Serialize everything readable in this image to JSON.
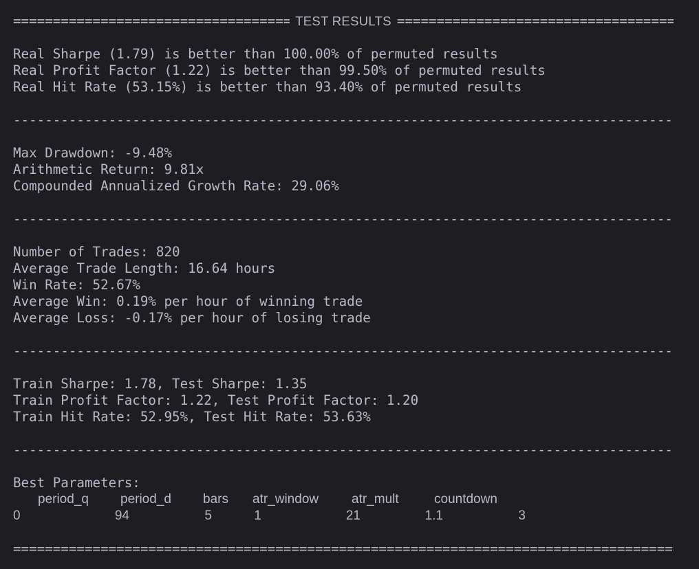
{
  "header": {
    "title": "TEST RESULTS",
    "fill": "================================================================"
  },
  "rules": {
    "equals": "=============================================================================================",
    "dashes": "---------------------------------------------------------------------------------------------"
  },
  "permutation": {
    "line1": "Real Sharpe (1.79) is better than 100.00% of permuted results",
    "line2": "Real Profit Factor (1.22) is better than 99.50% of permuted results",
    "line3": "Real Hit Rate (53.15%) is better than 93.40% of permuted results"
  },
  "returns": {
    "drawdown": "Max Drawdown: -9.48%",
    "arith": "Arithmetic Return: 9.81x",
    "cagr": "Compounded Annualized Growth Rate: 29.06%"
  },
  "trades": {
    "count": "Number of Trades: 820",
    "length": "Average Trade Length: 16.64 hours",
    "winrate": "Win Rate: 52.67%",
    "avgwin": "Average Win: 0.19% per hour of winning trade",
    "avgloss": "Average Loss: -0.17% per hour of losing trade"
  },
  "split": {
    "sharpe": "Train Sharpe: 1.78, Test Sharpe: 1.35",
    "pf": "Train Profit Factor: 1.22, Test Profit Factor: 1.20",
    "hit": "Train Hit Rate: 52.95%, Test Hit Rate: 53.63%"
  },
  "params": {
    "label": "Best Parameters:",
    "columns": [
      "period_q",
      "period_d",
      "bars",
      "atr_window",
      "atr_mult",
      "countdown"
    ],
    "row": {
      "index": "0",
      "values": [
        "94",
        "5",
        "1",
        "21",
        "1.1",
        "3"
      ]
    }
  }
}
